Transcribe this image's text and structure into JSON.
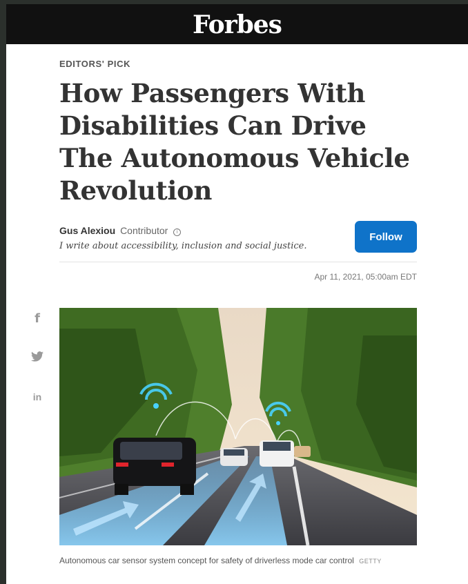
{
  "masthead": {
    "logo": "Forbes"
  },
  "article": {
    "kicker": "EDITORS' PICK",
    "headline": "How Passengers With Disabilities Can Drive The Autonomous Vehicle Revolution",
    "author": {
      "name": "Gus Alexiou",
      "role": "Contributor",
      "bio": "I write about accessibility, inclusion and social justice."
    },
    "follow_label": "Follow",
    "timestamp": "Apr 11, 2021, 05:00am EDT",
    "image": {
      "caption": "Autonomous car sensor system concept for safety of driverless mode car control",
      "credit": "GETTY"
    }
  },
  "social": [
    "facebook-icon",
    "twitter-icon",
    "linkedin-icon"
  ],
  "social_labels": {
    "facebook": "f",
    "linkedin": "in"
  },
  "colors": {
    "masthead": "#111111",
    "follow": "#0f73c9",
    "frame": "#2b302c"
  }
}
